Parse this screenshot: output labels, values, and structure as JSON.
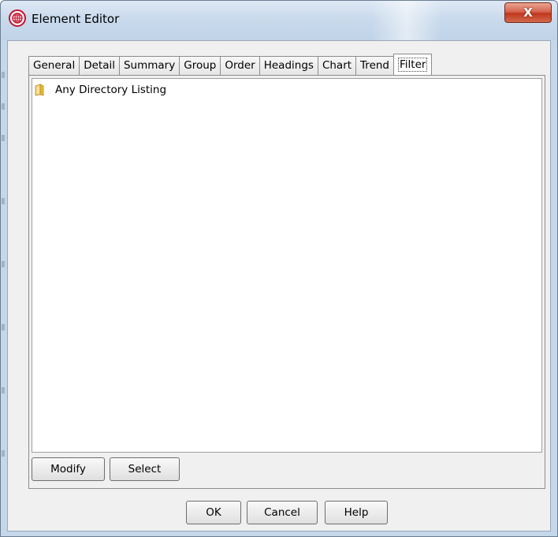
{
  "window": {
    "title": "Element Editor",
    "close_glyph": "X"
  },
  "tabs": [
    {
      "label": "General"
    },
    {
      "label": "Detail"
    },
    {
      "label": "Summary"
    },
    {
      "label": "Group"
    },
    {
      "label": "Order"
    },
    {
      "label": "Headings"
    },
    {
      "label": "Chart"
    },
    {
      "label": "Trend"
    },
    {
      "label": "Filter",
      "selected": true
    }
  ],
  "filter_list": {
    "items": [
      {
        "label": "Any Directory Listing",
        "icon": "folder-icon"
      }
    ]
  },
  "panel_buttons": {
    "modify": "Modify",
    "select": "Select"
  },
  "dialog_buttons": {
    "ok": "OK",
    "cancel": "Cancel",
    "help": "Help"
  },
  "colors": {
    "close_button": "#c0371d",
    "app_icon": "#c8102e",
    "folder": "#e8b93a"
  }
}
